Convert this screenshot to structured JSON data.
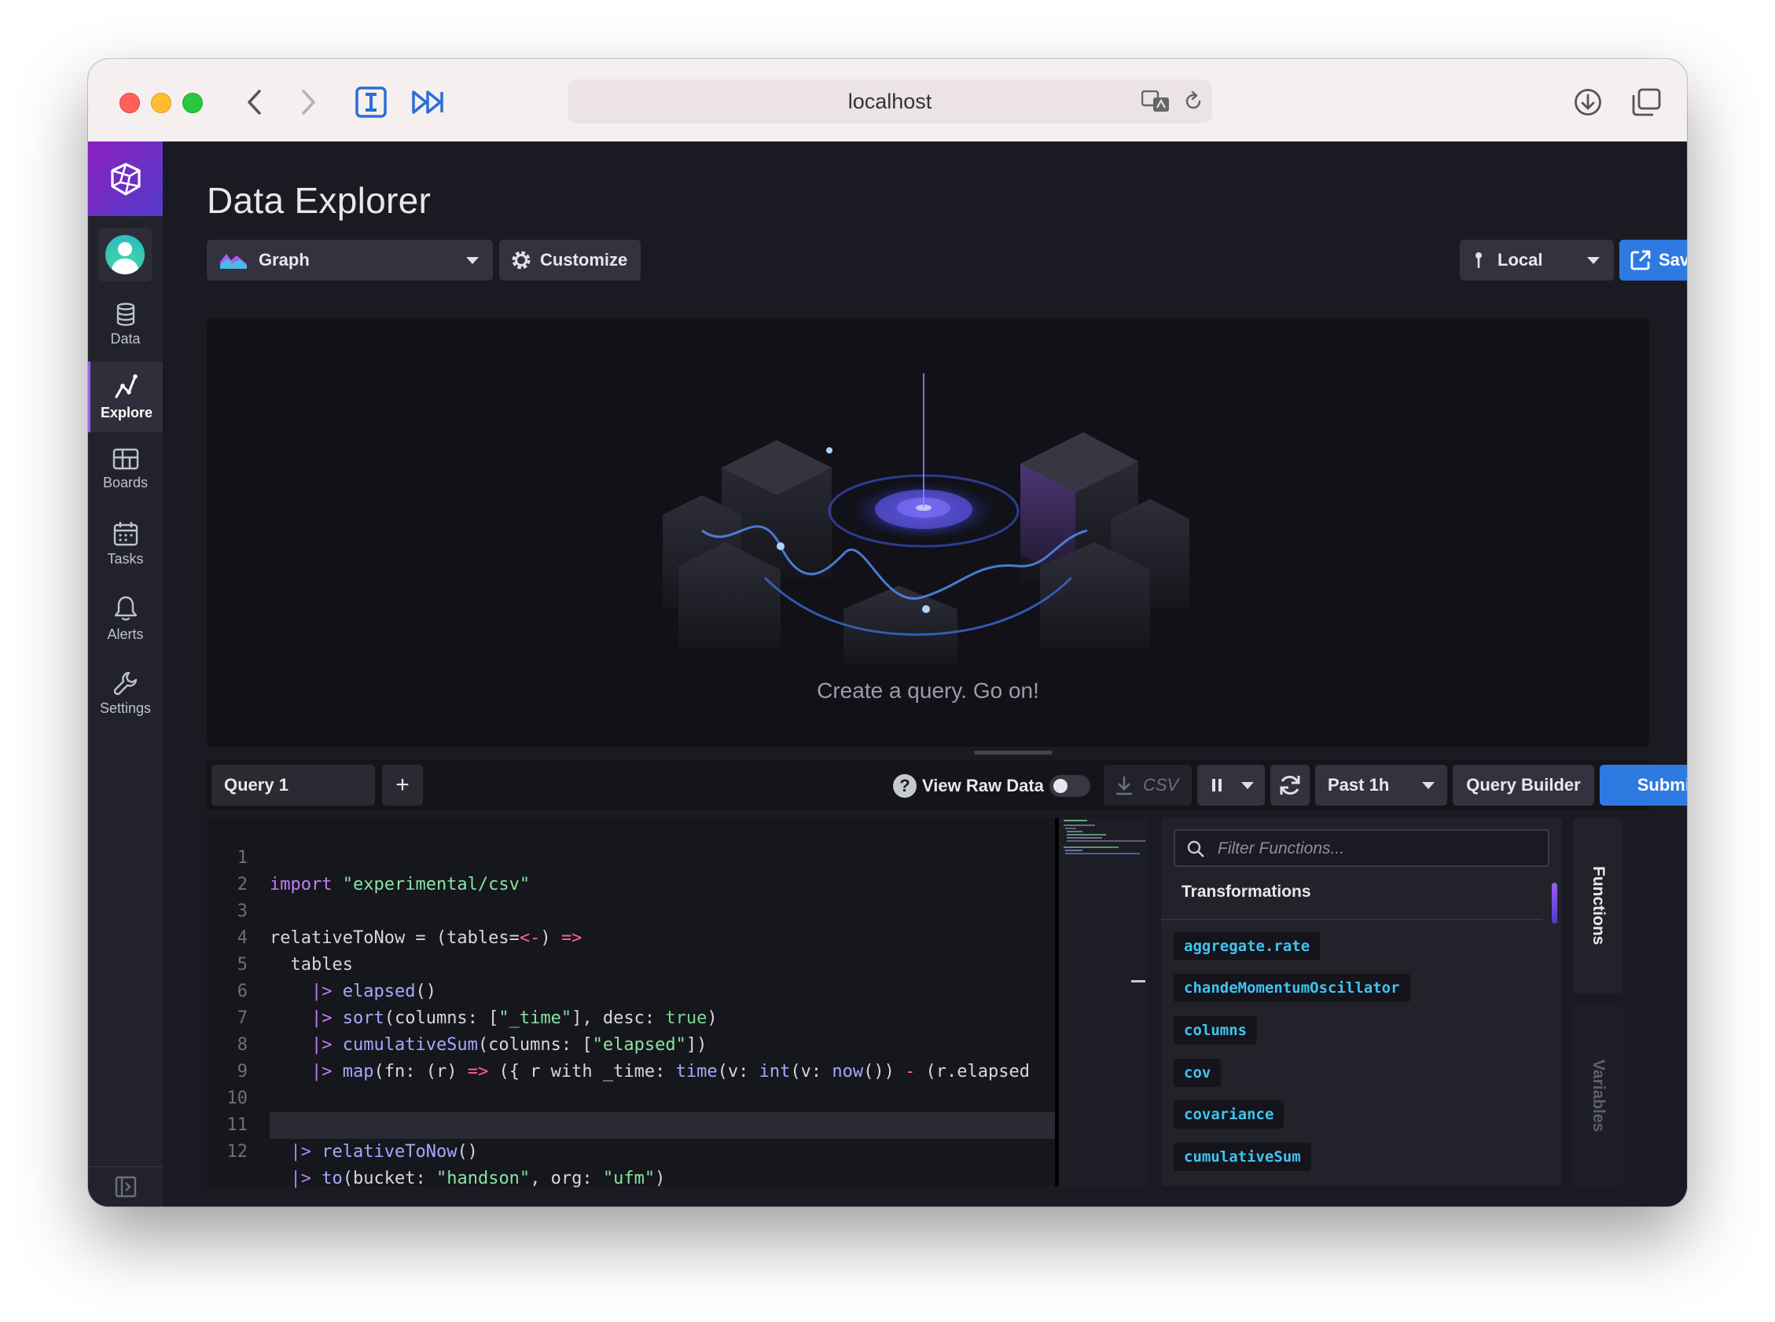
{
  "browser": {
    "url": "localhost"
  },
  "sidebar": {
    "items": [
      {
        "label": "Data",
        "icon": "database-icon"
      },
      {
        "label": "Explore",
        "icon": "explore-icon",
        "active": true
      },
      {
        "label": "Boards",
        "icon": "boards-icon"
      },
      {
        "label": "Tasks",
        "icon": "calendar-icon"
      },
      {
        "label": "Alerts",
        "icon": "bell-icon"
      },
      {
        "label": "Settings",
        "icon": "wrench-icon"
      }
    ]
  },
  "header": {
    "title": "Data Explorer",
    "graph_type": "Graph",
    "customize_label": "Customize",
    "connection": "Local",
    "save_as_label": "Save As"
  },
  "graph": {
    "empty_message": "Create a query. Go on!"
  },
  "query_toolbar": {
    "query_tab": "Query 1",
    "add_label": "+",
    "raw_data_label": "View Raw Data",
    "raw_data_enabled": false,
    "csv_label": "CSV",
    "time_range": "Past 1h",
    "query_builder_label": "Query Builder",
    "submit_label": "Submit"
  },
  "editor": {
    "line_numbers": [
      "1",
      "2",
      "3",
      "4",
      "5",
      "6",
      "7",
      "8",
      "9",
      "10",
      "11",
      "12"
    ]
  },
  "functions_panel": {
    "filter_placeholder": "Filter Functions...",
    "category": "Transformations",
    "functions": [
      "aggregate.rate",
      "chandeMomentumOscillator",
      "columns",
      "cov",
      "covariance",
      "cumulativeSum"
    ]
  },
  "side_tabs": {
    "functions": "Functions",
    "variables": "Variables"
  },
  "colors": {
    "accent": "#2f7ae0",
    "brand_gradient_start": "#8e1fc3",
    "brand_gradient_end": "#513cc6",
    "function_chip_text": "#3fc3f2"
  }
}
